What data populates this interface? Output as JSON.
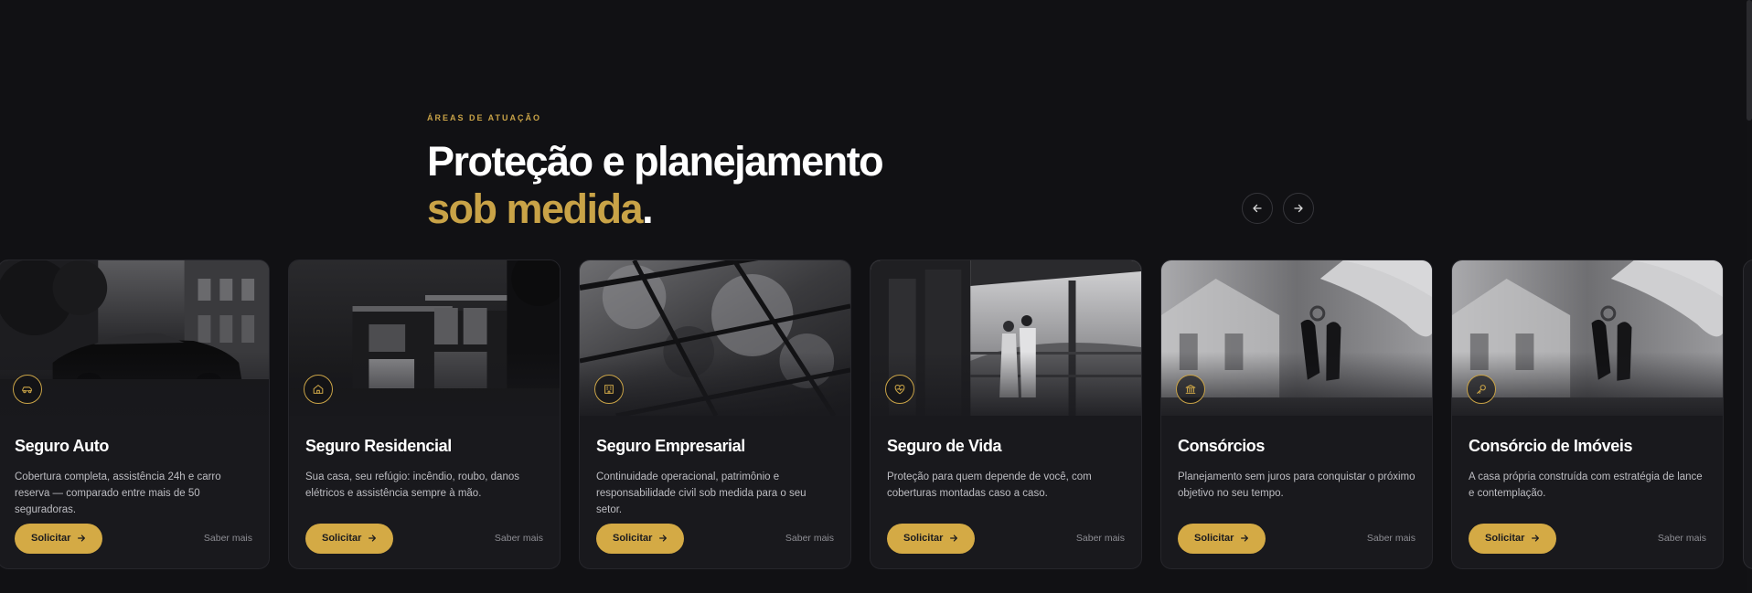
{
  "section": {
    "eyebrow": "ÁREAS DE ATUAÇÃO",
    "headline_line1": "Proteção e planejamento",
    "headline_line2": "sob medida",
    "headline_dot": "."
  },
  "colors": {
    "background": "#111114",
    "accent": "#c9a347",
    "button": "#d4aa45",
    "card": "#19191d"
  },
  "carousel": {
    "prev_icon": "arrow-left-icon",
    "next_icon": "arrow-right-icon",
    "cards": [
      {
        "icon": "car-icon",
        "title": "Seguro Auto",
        "description": "Cobertura completa, assistência 24h e carro reserva — comparado entre mais de 50 seguradoras.",
        "cta": "Solicitar",
        "link": "Saber mais"
      },
      {
        "icon": "home-icon",
        "title": "Seguro Residencial",
        "description": "Sua casa, seu refúgio: incêndio, roubo, danos elétricos e assistência sempre à mão.",
        "cta": "Solicitar",
        "link": "Saber mais"
      },
      {
        "icon": "building-icon",
        "title": "Seguro Empresarial",
        "description": "Continuidade operacional, patrimônio e responsabilidade civil sob medida para o seu setor.",
        "cta": "Solicitar",
        "link": "Saber mais"
      },
      {
        "icon": "heart-pulse-icon",
        "title": "Seguro de Vida",
        "description": "Proteção para quem depende de você, com coberturas montadas caso a caso.",
        "cta": "Solicitar",
        "link": "Saber mais"
      },
      {
        "icon": "bank-icon",
        "title": "Consórcios",
        "description": "Planejamento sem juros para conquistar o próximo objetivo no seu tempo.",
        "cta": "Solicitar",
        "link": "Saber mais"
      },
      {
        "icon": "key-icon",
        "title": "Consórcio de Imóveis",
        "description": "A casa própria construída com estratégia de lance e contemplação.",
        "cta": "Solicitar",
        "link": "Saber mais"
      }
    ]
  }
}
